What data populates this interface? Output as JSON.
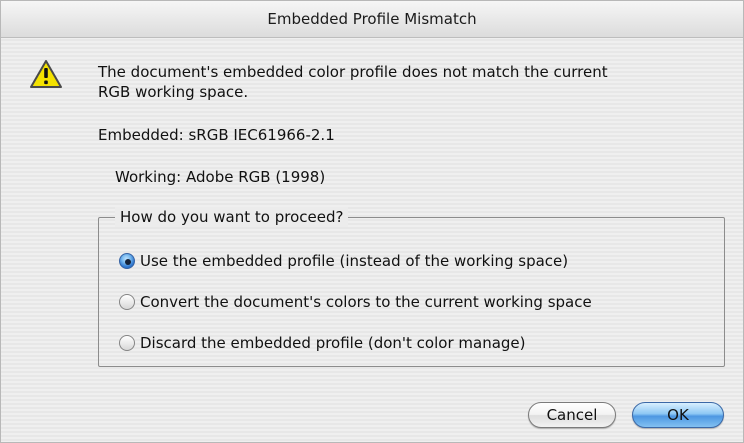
{
  "window": {
    "title": "Embedded Profile Mismatch"
  },
  "dialog": {
    "message_line_1": "The document's embedded color profile does not match the current",
    "message_line_2": "RGB working space.",
    "embedded_text": "Embedded: sRGB IEC61966-2.1",
    "working_text": "Working: Adobe RGB (1998)",
    "group_label": "How do you want to proceed?",
    "options": [
      {
        "label": "Use the embedded profile (instead of the working space)",
        "selected": true
      },
      {
        "label": "Convert the document's colors to the current working space",
        "selected": false
      },
      {
        "label": "Discard the embedded profile (don't color manage)",
        "selected": false
      }
    ],
    "buttons": {
      "cancel": "Cancel",
      "ok": "OK"
    }
  },
  "icons": {
    "warning": "warning-icon"
  },
  "colors": {
    "accent": "#4d97e2",
    "warning_fill": "#f4e200",
    "warning_stroke": "#4a4a4a"
  }
}
